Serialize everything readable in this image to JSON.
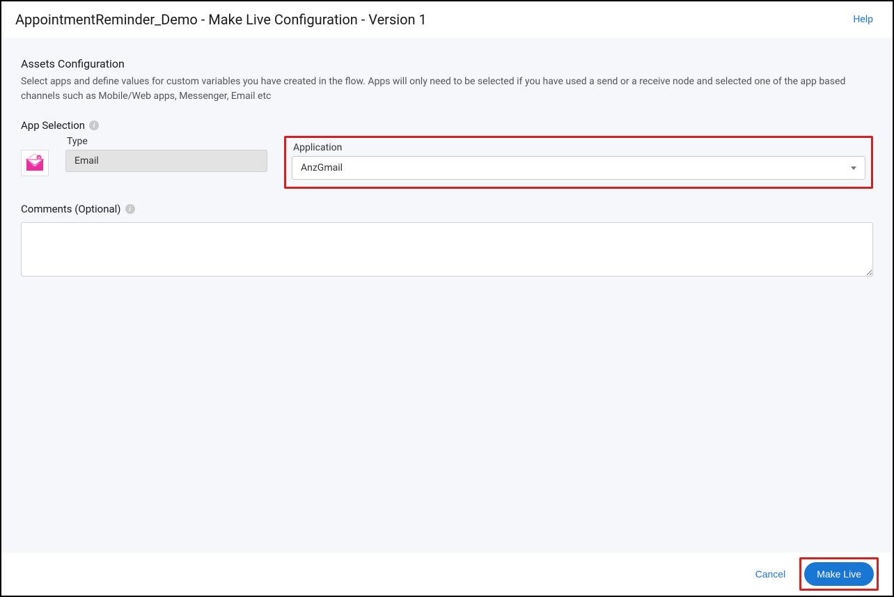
{
  "header": {
    "title": "AppointmentReminder_Demo - Make Live Configuration - Version 1",
    "help_label": "Help"
  },
  "assets": {
    "title": "Assets Configuration",
    "description": "Select apps and define values for custom variables you have created in the flow. Apps will only need to be selected if you have used a send or a receive node and selected one of the app based channels such as Mobile/Web apps, Messenger, Email etc"
  },
  "app_selection": {
    "label": "App Selection",
    "type_label": "Type",
    "type_value": "Email",
    "application_label": "Application",
    "application_value": "AnzGmail"
  },
  "comments": {
    "label": "Comments (Optional)",
    "value": ""
  },
  "footer": {
    "cancel_label": "Cancel",
    "make_live_label": "Make Live"
  }
}
